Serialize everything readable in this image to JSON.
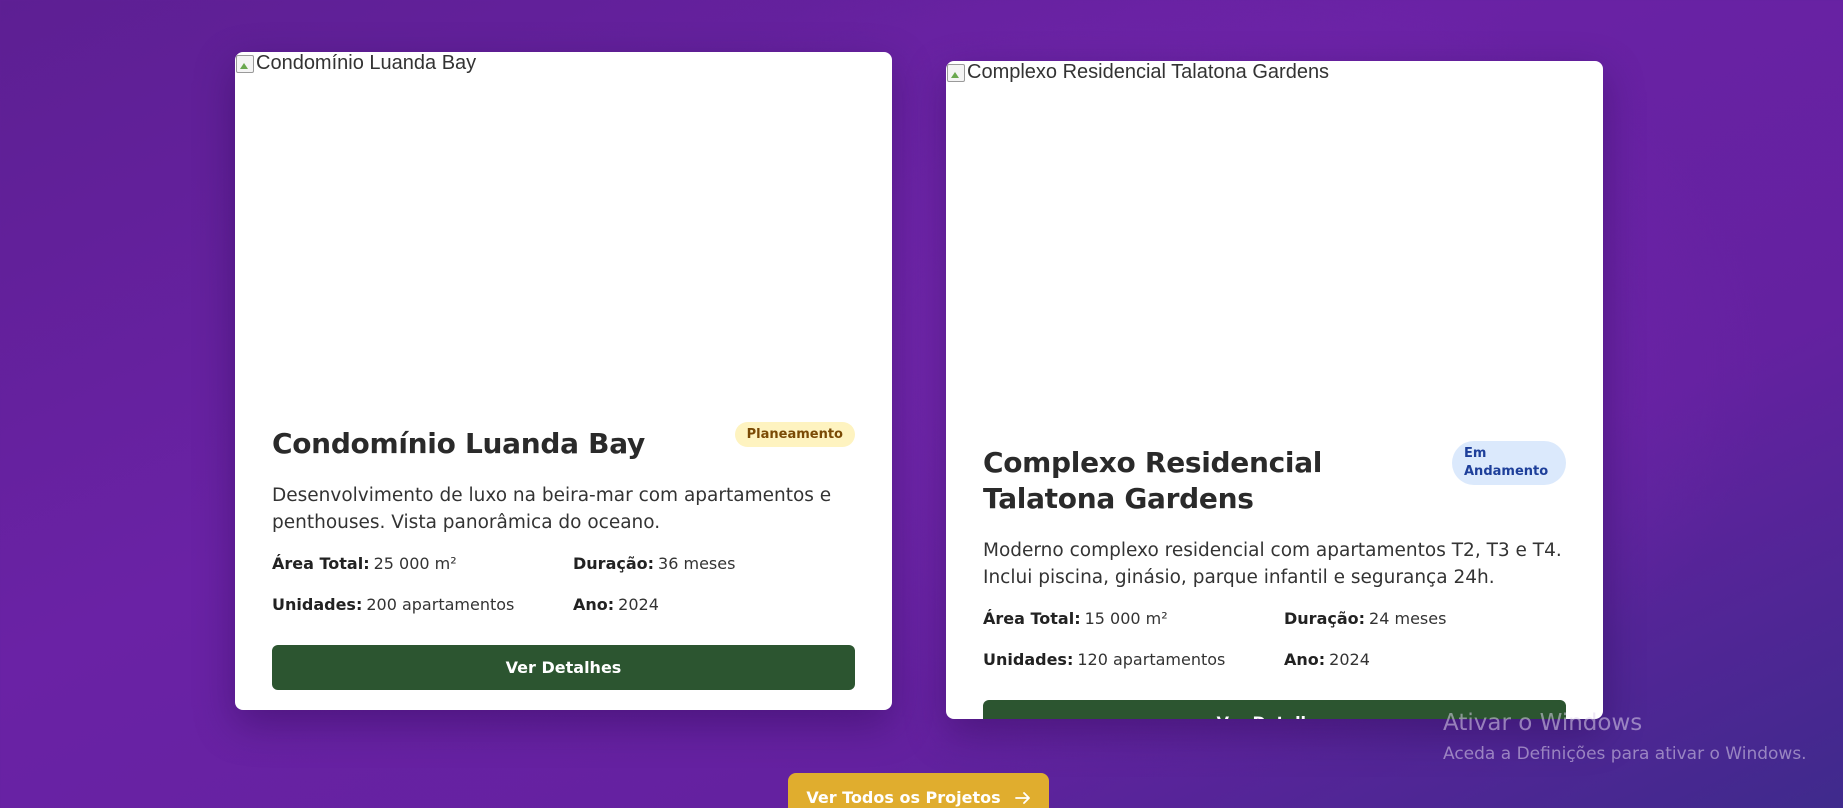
{
  "projects": [
    {
      "image_alt": "Condomínio Luanda Bay",
      "title": "Condomínio Luanda Bay",
      "status": "Planeamento",
      "status_color": "#fef3c0",
      "description": "Desenvolvimento de luxo na beira-mar com apartamentos e penthouses. Vista panorâmica do oceano.",
      "area_label": "Área Total:",
      "area_value": "25 000 m²",
      "duration_label": "Duração:",
      "duration_value": "36 meses",
      "units_label": "Unidades:",
      "units_value": "200 apartamentos",
      "year_label": "Ano:",
      "year_value": "2024",
      "button_label": "Ver Detalhes"
    },
    {
      "image_alt": "Complexo Residencial Talatona Gardens",
      "title": "Complexo Residencial Talatona Gardens",
      "status": "Em Andamento",
      "status_color": "#dbe9fc",
      "description": "Moderno complexo residencial com apartamentos T2, T3 e T4. Inclui piscina, ginásio, parque infantil e segurança 24h.",
      "area_label": "Área Total:",
      "area_value": "15 000 m²",
      "duration_label": "Duração:",
      "duration_value": "24 meses",
      "units_label": "Unidades:",
      "units_value": "120 apartamentos",
      "year_label": "Ano:",
      "year_value": "2024",
      "button_label": "Ver Detalhes"
    }
  ],
  "view_all": {
    "label": "Ver Todos os Projetos",
    "icon": "arrow-right-icon",
    "color": "#e0ad2e"
  },
  "accent": {
    "primary_button": "#2c5530",
    "background": "#6a22a5"
  },
  "windows_watermark": {
    "title": "Ativar o Windows",
    "subtitle": "Aceda a Definições para ativar o Windows."
  }
}
